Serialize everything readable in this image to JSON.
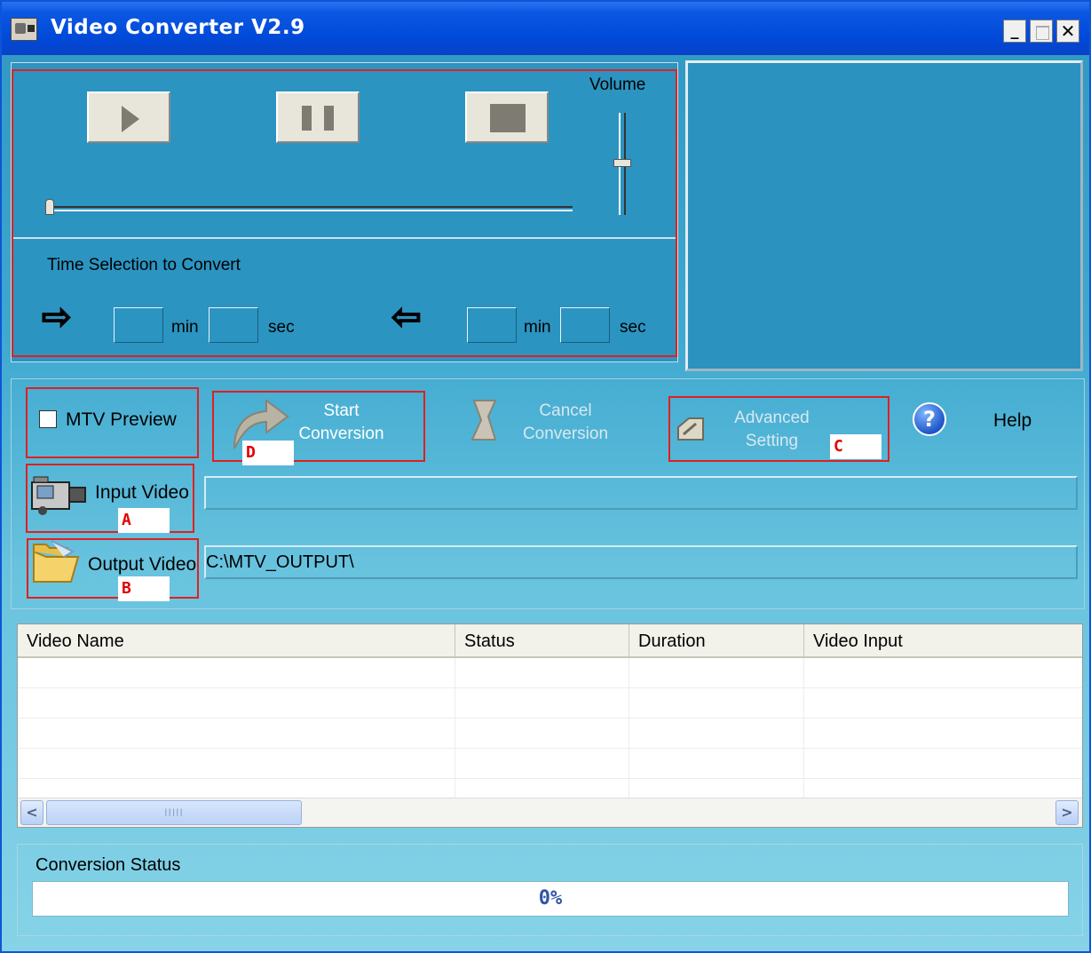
{
  "window": {
    "title": "Video Converter V2.9"
  },
  "titlebar": {
    "minimize": "_",
    "maximize": "",
    "close": "✕"
  },
  "player": {
    "volume_label": "Volume",
    "volume_level": 0.55,
    "seek_position": 0.0,
    "time_selection_label": "Time Selection to Convert",
    "start": {
      "min_value": "",
      "min_unit": "min",
      "sec_value": "",
      "sec_unit": "sec"
    },
    "end": {
      "min_value": "",
      "min_unit": "min",
      "sec_value": "",
      "sec_unit": "sec"
    },
    "arrow_right": "⇨",
    "arrow_left": "⇦"
  },
  "toolbar": {
    "mtv_preview_label": "MTV Preview",
    "mtv_preview_checked": false,
    "start_conversion": [
      "Start",
      "Conversion"
    ],
    "cancel_conversion": [
      "Cancel",
      "Conversion"
    ],
    "advanced_setting": [
      "Advanced",
      "Setting"
    ],
    "help_icon": "?",
    "help_label": "Help"
  },
  "markers": {
    "a": "A",
    "b": "B",
    "c": "C",
    "d": "D"
  },
  "input_video": {
    "label": "Input Video",
    "value": ""
  },
  "output_video": {
    "label": "Output Video",
    "value": "C:\\MTV_OUTPUT\\"
  },
  "table": {
    "columns": [
      "Video Name",
      "Status",
      "Duration",
      "Video Input"
    ],
    "rows": [],
    "scroll_left": "<",
    "scroll_right": ">",
    "scroll_grip": "IIIII"
  },
  "status": {
    "label": "Conversion Status",
    "progress_text": "0%",
    "progress": 0
  },
  "colors": {
    "accent_red": "#e02020",
    "title_blue": "#0b57e3",
    "panel_blue": "#2b94c1"
  }
}
